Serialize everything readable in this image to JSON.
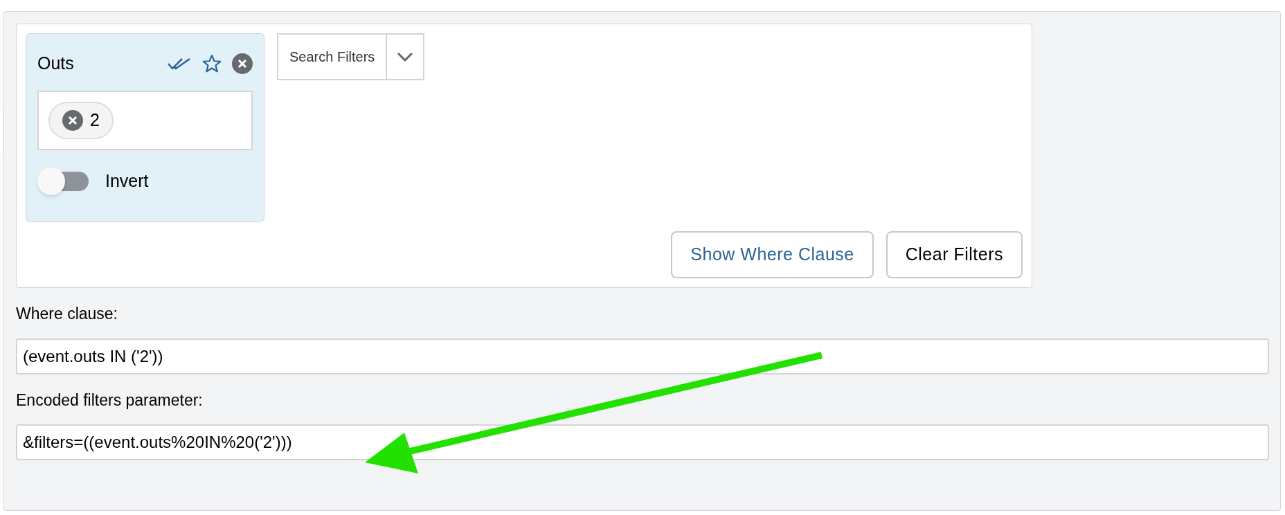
{
  "filter_card": {
    "title": "Outs",
    "values": [
      {
        "label": "2"
      }
    ],
    "invert": {
      "label": "Invert",
      "on": false
    }
  },
  "search_filters": {
    "label": "Search Filters"
  },
  "buttons": [
    {
      "label": "Show Where Clause",
      "kind": "link"
    },
    {
      "label": "Clear Filters",
      "kind": "default"
    }
  ],
  "where_clause": {
    "label": "Where clause:",
    "value": "(event.outs IN ('2'))"
  },
  "encoded_filters": {
    "label": "Encoded filters parameter:",
    "value": "&filters=((event.outs%20IN%20('2')))"
  }
}
